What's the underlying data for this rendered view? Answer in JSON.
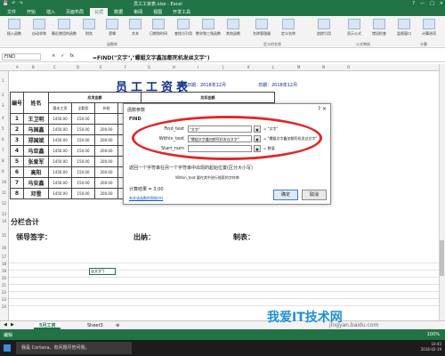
{
  "window": {
    "title": "员工工资表.xlsx - Excel",
    "controls": [
      "?",
      "—",
      "□",
      "×"
    ]
  },
  "quick_access": [
    "💾",
    "↶",
    "↷"
  ],
  "ribbon_tabs": [
    "文件",
    "开始",
    "插入",
    "页面布局",
    "公式",
    "数据",
    "审阅",
    "视图",
    "开发工具"
  ],
  "ribbon_active_tab": "公式",
  "ribbon_buttons": [
    "插入函数",
    "自动求和",
    "最近使用的函数",
    "财务",
    "逻辑",
    "文本",
    "日期和时间",
    "查找与引用",
    "数学和三角函数",
    "其他函数",
    "名称管理器",
    "定义名称",
    "追踪引用",
    "显示公式",
    "错误检查",
    "监视窗口",
    "计算选项"
  ],
  "ribbon_groups": [
    "函数库",
    "定义的名称",
    "公式审核",
    "计算"
  ],
  "formula_bar": {
    "name_box": "FIND",
    "icons": [
      "×",
      "✓",
      "fx"
    ],
    "formula": "=FIND(\"文字\",\"螺蛆文字鑫加都死机发丝文字\")"
  },
  "columns": [
    "A",
    "B",
    "C",
    "D",
    "E",
    "F",
    "G",
    "H",
    "I",
    "J",
    "K",
    "L",
    "M",
    "N",
    "O"
  ],
  "rows": [
    "1",
    "2",
    "3",
    "4",
    "5",
    "6",
    "7",
    "8",
    "9",
    "10",
    "11",
    "12",
    "13",
    "14",
    "15",
    "16",
    "17",
    "18",
    "19",
    "20",
    "21",
    "22",
    "23",
    "24"
  ],
  "sheet": {
    "title": "员工工资表",
    "meta_left": "制表日期：2018年12月",
    "meta_right": "日期：2018年12月",
    "group1": "应发金额",
    "group2": "应扣金额",
    "col_index": "编号",
    "col_name": "姓名",
    "sub_cols": [
      "基本工资",
      "全勤奖",
      "补助",
      "奖励"
    ],
    "employees": [
      {
        "idx": "1",
        "name": "王卫明",
        "base": "1450.00",
        "v2": "150.00",
        "v3": "",
        "v4": "1000.00"
      },
      {
        "idx": "2",
        "name": "马国鑫",
        "base": "1450.00",
        "v2": "150.00",
        "v3": "200.00",
        "v4": "900.00"
      },
      {
        "idx": "3",
        "name": "郑国斌",
        "base": "1450.00",
        "v2": "150.00",
        "v3": "200.00",
        "v4": ""
      },
      {
        "idx": "4",
        "name": "马亚鑫",
        "base": "1450.00",
        "v2": "150.00",
        "v3": "200.00",
        "v4": ""
      },
      {
        "idx": "5",
        "name": "张爱军",
        "base": "1450.00",
        "v2": "150.00",
        "v3": "200.00",
        "v4": ""
      },
      {
        "idx": "6",
        "name": "高阳",
        "base": "1450.00",
        "v2": "150.00",
        "v3": "200.00",
        "v4": ""
      },
      {
        "idx": "7",
        "name": "马安鑫",
        "base": "1450.00",
        "v2": "150.00",
        "v3": "200.00",
        "v4": ""
      },
      {
        "idx": "8",
        "name": "邓雪",
        "base": "1450.00",
        "v2": "150.00",
        "v3": "200.00",
        "v4": ""
      }
    ],
    "total_label": "分栏合计",
    "sig_leader": "领导签字：",
    "sig_cashier": "出纳：",
    "sig_maker": "制表：",
    "cell_edit": "丝文字\")"
  },
  "dialog": {
    "title": "函数参数",
    "close": "?  ×",
    "function_name": "FIND",
    "args": [
      {
        "label": "Find_text",
        "value": "\"文字\"",
        "result": "= \"文字\""
      },
      {
        "label": "Within_text",
        "value": "\"螺蛆文字鑫加都死机发丝文字\"",
        "result": "= \"螺蛆文字鑫加都死机发丝文字\""
      },
      {
        "label": "Start_num",
        "value": "",
        "result": "= 数值"
      }
    ],
    "description": "返回一个字符串在另一个字符串中出现的起始位置(区分大小写)",
    "sub_description": "Within_text  要在其中进行搜索的字符串",
    "result_line": "计算结果 =  3.00",
    "help_link": "有关该函数的帮助(H)",
    "ok": "确定",
    "cancel": "取消"
  },
  "sheet_tabs": [
    "5月工资",
    "Sheet3",
    "⊕"
  ],
  "sheet_active": "5月工资",
  "status": {
    "left": "编辑",
    "right": "100%"
  },
  "taskbar": {
    "search": "我是 Cortana。有问题尽管问我。",
    "time": "10:45",
    "date": "2016-02-19"
  },
  "watermark": {
    "text": "我爱IT技术网",
    "url": "jingyan.baidu.com"
  }
}
